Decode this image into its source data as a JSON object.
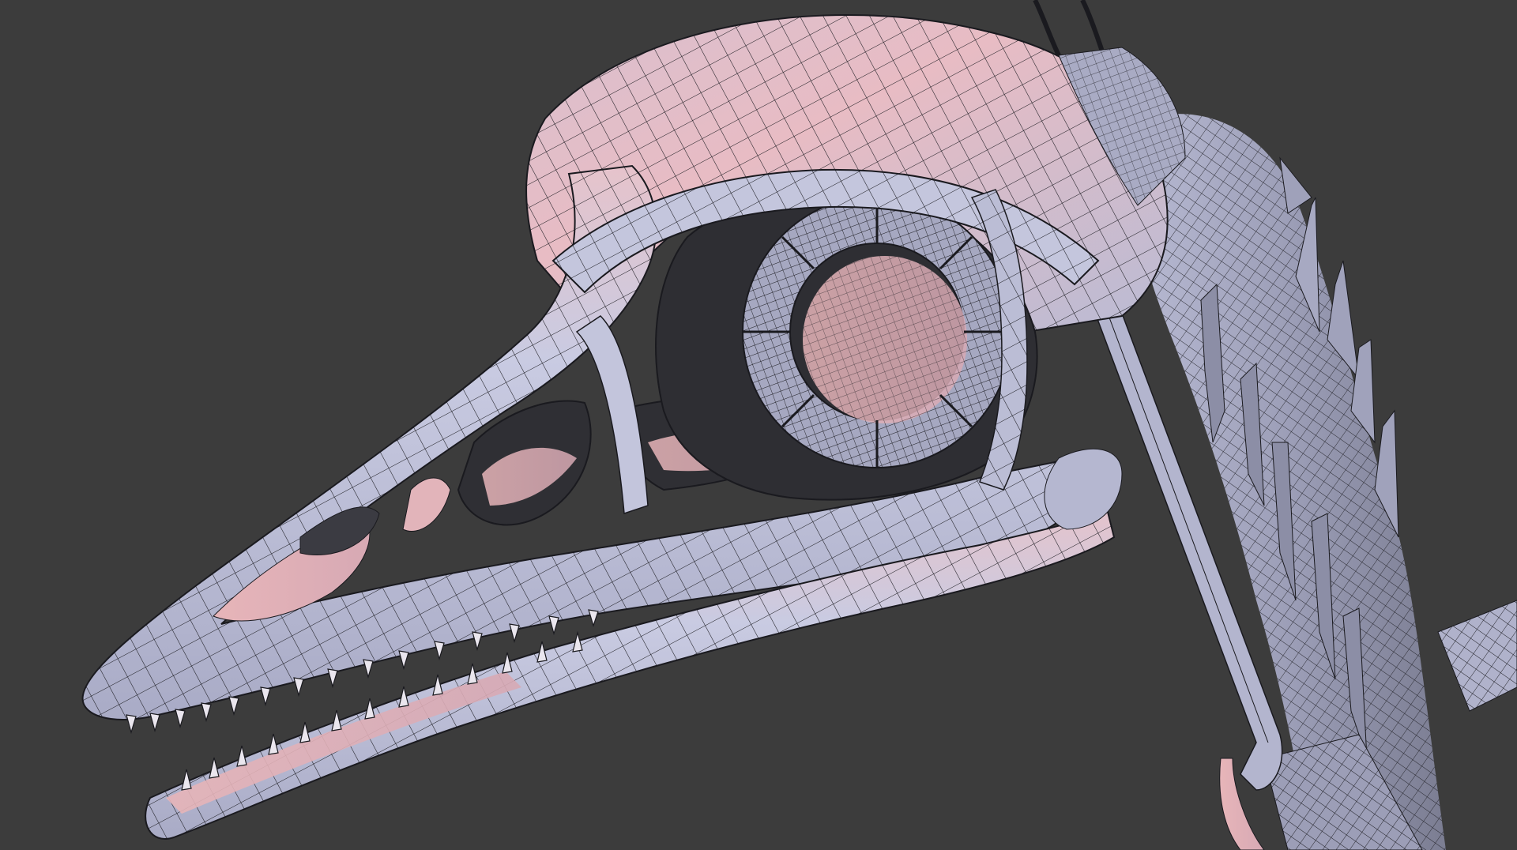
{
  "viewport": {
    "background": "#3c3c3c",
    "shading": "wireframe-on-shaded",
    "subject": "skull-and-neck-mesh"
  },
  "colors": {
    "bone_light": "#c9cbe2",
    "bone_mid": "#b4b6cf",
    "bone_shadow": "#8e90a8",
    "tint_pink": "#e8b9bd",
    "wire": "#1a1a1f",
    "tooth": "#eae6ee"
  }
}
